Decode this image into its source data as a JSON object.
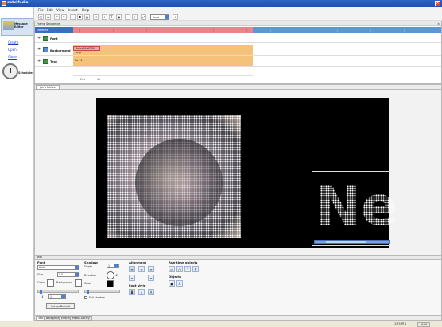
{
  "app": {
    "title": "ootvMedia"
  },
  "sidebar": {
    "editor_label": "Message Editor",
    "links": [
      "Create",
      "Open",
      "Close"
    ],
    "scheduler_label": "Scheduler"
  },
  "menu": [
    "File",
    "Edit",
    "View",
    "Insert",
    "Help"
  ],
  "toolbar": {
    "zoom_value": "Auto"
  },
  "frame_sequence": {
    "title": "Frame Sequence",
    "timeline_label": "Timeline",
    "tracks": [
      {
        "label": "Font"
      },
      {
        "label": "Background",
        "clip": "Sailes06.WPG0 bmp"
      },
      {
        "label": "Text",
        "clip": "Nev 2"
      }
    ],
    "time_labels": [
      "20s",
      "0s"
    ]
  },
  "preview": {
    "tab": "Joe's Coffee",
    "glyph": "Ne"
  },
  "properties": {
    "header": "Text",
    "font": {
      "title": "Font",
      "name": "Arial",
      "size_label": "Size",
      "size": "5.0",
      "color_label": "Color",
      "background_label": "Background",
      "spin_value": "1",
      "set_default": "Set as Default"
    },
    "shadow": {
      "title": "Shadow",
      "depth_label": "Depth",
      "depth": "1",
      "direction_label": "Direction",
      "direction": "45",
      "color_label": "Color",
      "full_shadow": "Full shadow"
    },
    "alignment": {
      "title": "Alignment",
      "font_style_title": "Font style"
    },
    "runtime": {
      "title": "Run-time objects",
      "objects_title": "Objects"
    }
  },
  "bottom_tabs": [
    "Text",
    "Background",
    "Effects",
    "Media Library"
  ],
  "status": {
    "zoom": "1:75 @ 1",
    "caps": "NUM"
  },
  "colors": {
    "titlebar": "#2f63c7",
    "ruler": "#5b97d6",
    "ruler_active": "#e8858b",
    "clip": "#f5c27b"
  }
}
